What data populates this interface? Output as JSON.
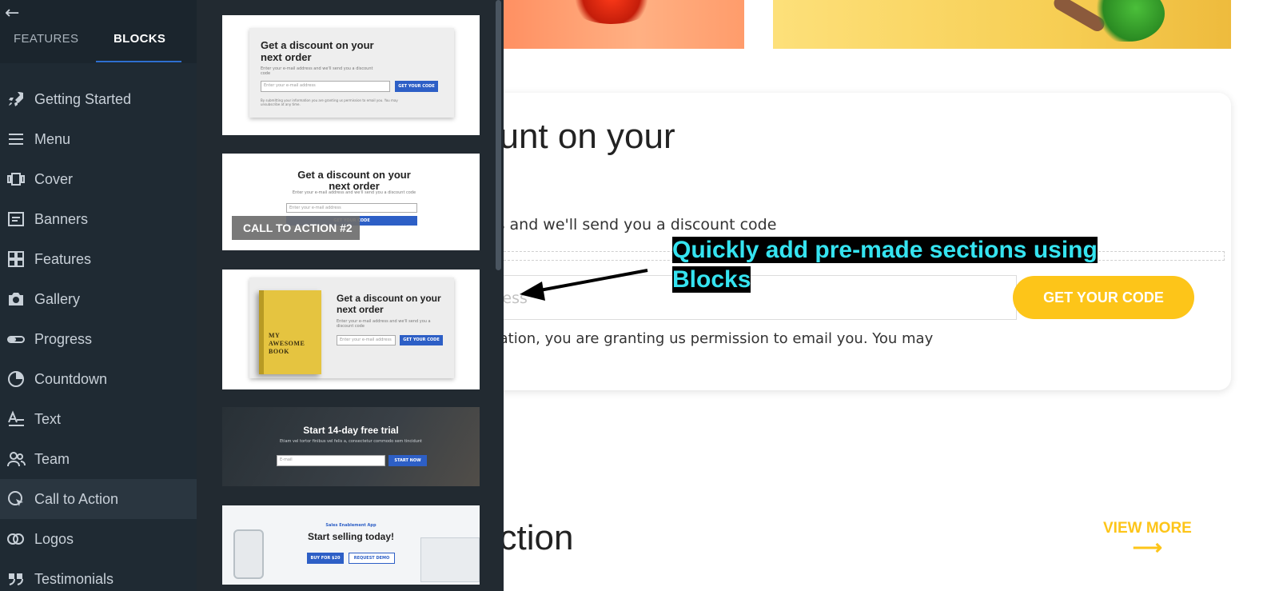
{
  "nav": {
    "back_icon": "←",
    "tabs": {
      "features": "FEATURES",
      "blocks": "BLOCKS"
    },
    "items": [
      {
        "label": "Getting Started",
        "icon": "rocket-icon"
      },
      {
        "label": "Menu",
        "icon": "menu-icon"
      },
      {
        "label": "Cover",
        "icon": "cover-icon"
      },
      {
        "label": "Banners",
        "icon": "banners-icon"
      },
      {
        "label": "Features",
        "icon": "grid-icon"
      },
      {
        "label": "Gallery",
        "icon": "camera-icon"
      },
      {
        "label": "Progress",
        "icon": "progress-icon"
      },
      {
        "label": "Countdown",
        "icon": "clock-icon"
      },
      {
        "label": "Text",
        "icon": "text-icon"
      },
      {
        "label": "Team",
        "icon": "team-icon"
      },
      {
        "label": "Call to Action",
        "icon": "cta-icon",
        "active": true
      },
      {
        "label": "Logos",
        "icon": "logos-icon"
      },
      {
        "label": "Testimonials",
        "icon": "quote-icon"
      }
    ]
  },
  "blocks": {
    "thumb1": {
      "title": "Get a discount on your next order",
      "text": "Enter your e-mail address and we'll send you a discount code",
      "placeholder": "Enter your e-mail address",
      "button": "GET YOUR CODE",
      "legal": "By submitting your information you are granting us permission to email you. You may unsubscribe at any time."
    },
    "thumb2": {
      "title": "Get a discount on your next order",
      "text": "Enter your e-mail address and we'll send you a discount code",
      "placeholder": "Enter your e-mail address",
      "button": "GET YOUR CODE",
      "overlay_label": "CALL TO ACTION #2"
    },
    "thumb3": {
      "book_text": "MY AWESOME BOOK",
      "title": "Get a discount on your next order",
      "text": "Enter your e-mail address and we'll send you a discount code",
      "placeholder": "Enter your e-mail address",
      "button": "GET YOUR CODE"
    },
    "thumb4": {
      "title": "Start 14-day free trial",
      "text": "Etiam vel tortor finibus vel felis a, consectetur commodo sem tincidunt",
      "placeholder": "E-mail",
      "button": "START NOW"
    },
    "thumb5": {
      "kicker": "Sales Enablement App",
      "title": "Start selling today!",
      "button1": "BUY FOR $20",
      "button2": "REQUEST DEMO"
    }
  },
  "canvas": {
    "card": {
      "title": "ount on your",
      "subtitle": "ess and we'll send you a discount code",
      "input_placeholder": "ress",
      "button": "GET YOUR CODE",
      "legal_line1": "rmation, you are granting us permission to email you. You may",
      "legal_line2": "."
    },
    "section_title": "ection",
    "view_more": "VIEW MORE",
    "view_more_arrow": "⟶"
  },
  "annotation": {
    "line1": "Quickly add pre-made sections using",
    "line2": "Blocks",
    "color": "#35e3f0"
  },
  "colors": {
    "accent_yellow": "#fdc519",
    "nav_bg": "#1f2a33",
    "tab_underline": "#2e6fd0",
    "mini_button": "#2d5fc6"
  }
}
